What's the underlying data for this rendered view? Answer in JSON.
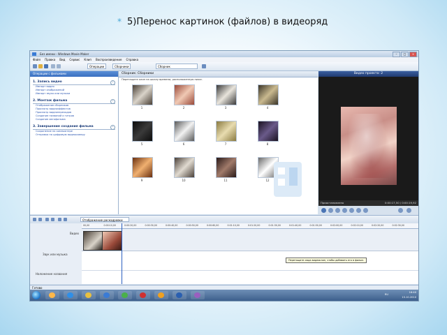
{
  "slide": {
    "bullet": "*",
    "title": "5)Перенос  картинок (файлов) в видеоряд"
  },
  "window": {
    "title": "Без имени - Windows Movie Maker"
  },
  "menu": [
    "Файл",
    "Правка",
    "Вид",
    "Сервис",
    "Клип",
    "Воспроизведение",
    "Справка"
  ],
  "toolbar": {
    "operations": "Операции",
    "collections": "Сборники",
    "current_collection": "Сборник"
  },
  "tasks": {
    "header": "Операции с фильмами",
    "sections": [
      {
        "title": "1. Запись видео",
        "items": [
          "Импорт видео",
          "Импорт изображений",
          "Импорт звука или музыки"
        ]
      },
      {
        "title": "2. Монтаж фильма",
        "items": [
          "Отображение сборников",
          "Просмотр видеоэффектов",
          "Просмотр видеопереходов",
          "Создание названий и титров",
          "Создание автофильма"
        ]
      },
      {
        "title": "3. Завершение создания фильма",
        "items": [
          "Сохранение на компьютере",
          "Отправка на цифровую видеокамеру"
        ]
      }
    ]
  },
  "collection": {
    "header": "Сборник: Сборники",
    "hint": "Перетащите клип на шкалу времени, расположенную ниже.",
    "thumbs": [
      {
        "num": "1",
        "colors": [
          "#d9d3c9",
          "#4a4036"
        ]
      },
      {
        "num": "2",
        "colors": [
          "#f0c9b4",
          "#9a4a3a"
        ]
      },
      {
        "num": "3",
        "colors": [
          "#e8e4dc",
          "#3a3a3a"
        ]
      },
      {
        "num": "4",
        "colors": [
          "#c9b98f",
          "#3a3428"
        ]
      },
      {
        "num": "5",
        "colors": [
          "#3a3a3a",
          "#0c0c0c"
        ]
      },
      {
        "num": "6",
        "colors": [
          "#f2f2f2",
          "#5a5a5a"
        ]
      },
      {
        "num": "7",
        "colors": [
          "#e8dcb0",
          "#8a7a40"
        ]
      },
      {
        "num": "8",
        "colors": [
          "#6a5a8a",
          "#1a1220"
        ]
      },
      {
        "num": "9",
        "colors": [
          "#f0b070",
          "#6a3010"
        ]
      },
      {
        "num": "10",
        "colors": [
          "#e0dad0",
          "#4a4038"
        ]
      },
      {
        "num": "11",
        "colors": [
          "#a07a6a",
          "#2a1a18"
        ]
      },
      {
        "num": "12",
        "colors": [
          "#ffffff",
          "#6a6a6a"
        ]
      }
    ]
  },
  "monitor": {
    "header": "Видео проекта: 2",
    "status": "Приостановлено",
    "time": "0:00:17,50 / 0:00:19,92"
  },
  "storyboard": {
    "label": "Отображение раскадровки"
  },
  "ruler": [
    "00,00",
    "0:00:10,00",
    "0:00:20,00",
    "0:00:30,00",
    "0:00:40,00",
    "0:00:50,00",
    "0:00:60,00",
    "0:01:10,00",
    "0:01:20,00",
    "0:01:30,00",
    "0:01:40,00",
    "0:01:50,00",
    "0:02:00,00",
    "0:02:10,00",
    "0:02:20,00",
    "0:02:30,00"
  ],
  "tracks": {
    "video": "Видео",
    "audio": "Звук или музыка",
    "titles": "Наложение названия"
  },
  "tooltip": "Перетащите сюда видеоклип, чтобы добавить его в фильм.",
  "status": "Готово",
  "taskbar": {
    "apps": [
      {
        "color": "#ffb84a"
      },
      {
        "color": "#2f8fe8"
      },
      {
        "color": "#e8c040"
      },
      {
        "color": "#3a7bd5"
      },
      {
        "color": "#4ab04a"
      },
      {
        "color": "#d03030"
      },
      {
        "color": "#f0a020"
      },
      {
        "color": "#2a5fb0"
      },
      {
        "color": "#9a5fc0"
      }
    ],
    "lang": "RU",
    "time": "16:40",
    "date": "15.10.2010"
  }
}
